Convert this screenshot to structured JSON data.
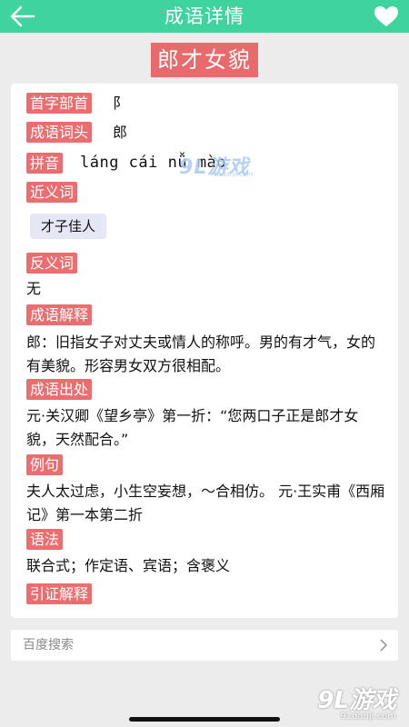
{
  "header": {
    "title": "成语详情",
    "back_icon": "arrow-left-icon",
    "favorite_icon": "heart-icon"
  },
  "idiom": {
    "word": "郎才女貌"
  },
  "details": {
    "radical_label": "首字部首",
    "radical_value": "阝",
    "head_label": "成语词头",
    "head_value": "郎",
    "pinyin_label": "拼音",
    "pinyin_value": "láng cái nǚ mào",
    "synonym_label": "近义词",
    "synonym_chip": "才子佳人",
    "antonym_label": "反义词",
    "antonym_value": "无",
    "explain_label": "成语解释",
    "explain_value": "郎：旧指女子对丈夫或情人的称呼。男的有才气，女的有美貌。形容男女双方很相配。",
    "source_label": "成语出处",
    "source_value": "元·关汉卿《望乡亭》第一折：“您两口子正是郎才女貌，天然配合。”",
    "example_label": "例句",
    "example_value": "夫人太过虑，小生空妄想，～合相仿。 元·王实甫《西厢记》第一本第二折",
    "usage_label": "语法",
    "usage_value": "联合式；作定语、宾语；含褒义",
    "citation_label": "引证解释"
  },
  "watermark_card": {
    "big": "9L游戏",
    "small": "91danji.com"
  },
  "search": {
    "placeholder": "百度搜索",
    "arrow_icon": "chevron-right-icon"
  },
  "watermark_corner": {
    "big": "9L游戏",
    "small": "91danji.com"
  },
  "colors": {
    "accent": "#3fd3a0",
    "tag": "#ea6e70",
    "chip": "#e6e7f6"
  }
}
